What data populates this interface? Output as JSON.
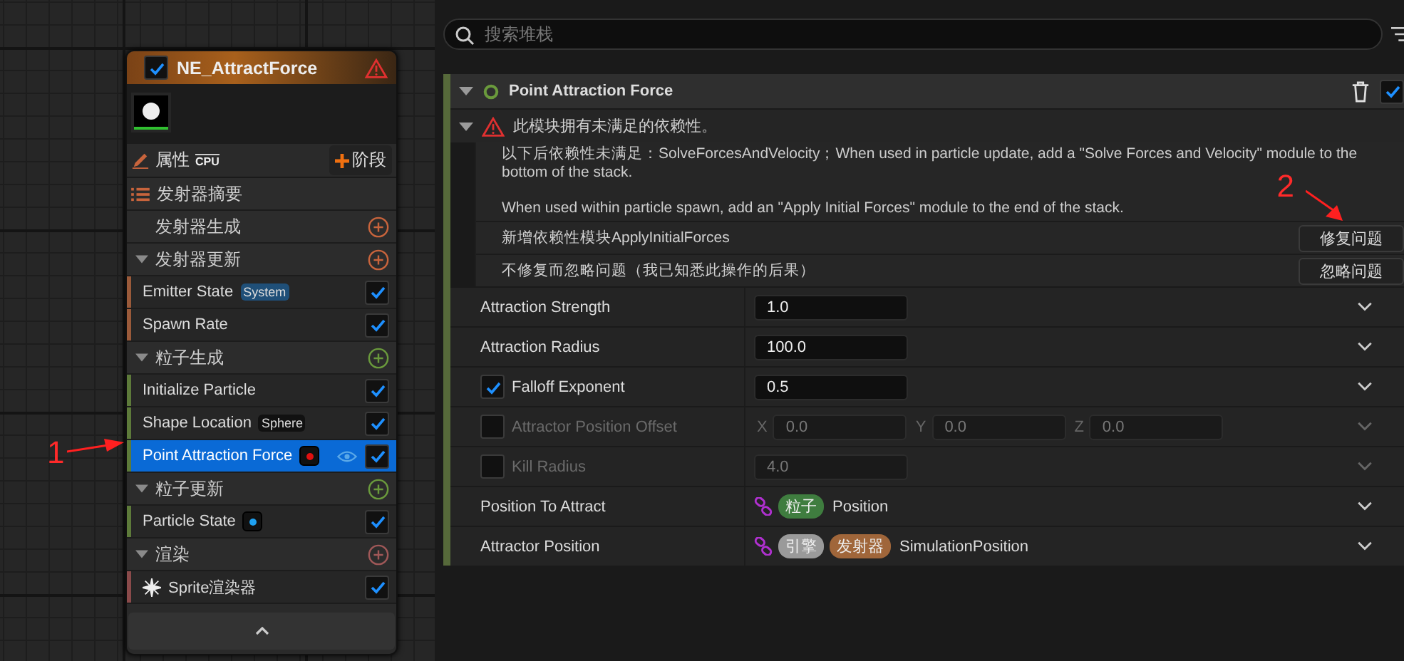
{
  "node": {
    "title": "NE_AttractForce",
    "enabled": true,
    "warning": true,
    "toolbar": {
      "label": "属性",
      "sim": "CPU",
      "button": "阶段"
    },
    "rows": [
      {
        "kind": "summary",
        "label": "发射器摘要"
      },
      {
        "kind": "section_plain",
        "label": "发射器生成",
        "color": "#c8643c"
      },
      {
        "kind": "section",
        "label": "发射器更新",
        "color": "#c8643c"
      },
      {
        "kind": "module",
        "label": "Emitter State",
        "tag": {
          "text": "System",
          "color": "#1f4f78"
        },
        "checked": true,
        "selected": false,
        "color": "#9a5a3a"
      },
      {
        "kind": "module",
        "label": "Spawn Rate",
        "checked": true,
        "selected": false,
        "color": "#9a5a3a"
      },
      {
        "kind": "section",
        "label": "粒子生成",
        "color": "#6a9a3c"
      },
      {
        "kind": "module",
        "label": "Initialize Particle",
        "checked": true,
        "selected": false,
        "color": "#5d7a3a"
      },
      {
        "kind": "module",
        "label": "Shape Location",
        "tag": {
          "text": "Sphere",
          "color": "#111111"
        },
        "checked": true,
        "selected": false,
        "color": "#5d7a3a"
      },
      {
        "kind": "module",
        "label": "Point Attraction Force",
        "dot": {
          "color": "#e01010"
        },
        "checked": true,
        "selected": true,
        "color": "#5d7a3a"
      },
      {
        "kind": "section",
        "label": "粒子更新",
        "color": "#6a9a3c"
      },
      {
        "kind": "module",
        "label": "Particle State",
        "dot": {
          "color": "#1ea0f0"
        },
        "checked": true,
        "selected": false,
        "color": "#5d7a3a"
      },
      {
        "kind": "section",
        "label": "渲染",
        "color": "#a05858"
      },
      {
        "kind": "renderer",
        "label": "Sprite渲染器",
        "checked": true,
        "selected": false,
        "color": "#8a4a4a"
      }
    ]
  },
  "annotations": [
    {
      "text": "1"
    },
    {
      "text": "2"
    }
  ],
  "search": {
    "placeholder": "搜索堆栈"
  },
  "module": {
    "title": "Point Attraction Force",
    "enabled": true,
    "warning": {
      "message": "此模块拥有未满足的依赖性。",
      "expanded": true,
      "details": [
        "以下后依赖性未满足：SolveForcesAndVelocity；When used in particle update, add a \"Solve Forces and Velocity\" module to the bottom of the stack.",
        "When used within particle spawn, add an \"Apply Initial Forces\" module to the end of the stack."
      ],
      "fixes": [
        {
          "text": "新增依赖性模块ApplyInitialForces",
          "button": "修复问题"
        },
        {
          "text": "不修复而忽略问题（我已知悉此操作的后果）",
          "button": "忽略问题"
        }
      ]
    },
    "params": [
      {
        "kind": "value",
        "label": "Attraction Strength",
        "value": "1.0"
      },
      {
        "kind": "value",
        "label": "Attraction Radius",
        "value": "100.0"
      },
      {
        "kind": "value",
        "label": "Falloff Exponent",
        "checked": true,
        "value": "0.5"
      },
      {
        "kind": "vector",
        "label": "Attractor Position Offset",
        "checked": false,
        "components": [
          {
            "axis": "X",
            "value": "0.0"
          },
          {
            "axis": "Y",
            "value": "0.0"
          },
          {
            "axis": "Z",
            "value": "0.0"
          }
        ]
      },
      {
        "kind": "value",
        "label": "Kill Radius",
        "checked": false,
        "value": "4.0"
      },
      {
        "kind": "link",
        "label": "Position To Attract",
        "tags": [
          {
            "text": "粒子",
            "color": "#3f7d3f"
          }
        ],
        "value": "Position"
      },
      {
        "kind": "link",
        "label": "Attractor Position",
        "tags": [
          {
            "text": "引擎",
            "color": "#9a9a9a"
          },
          {
            "text": "发射器",
            "color": "#a0663a"
          }
        ],
        "value": "SimulationPosition"
      }
    ]
  }
}
